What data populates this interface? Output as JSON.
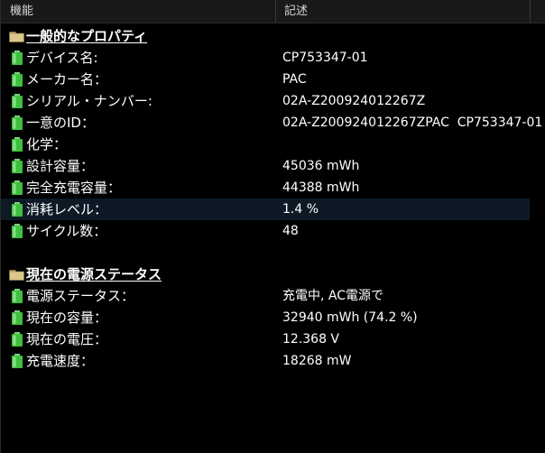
{
  "header": {
    "col_item": "機能",
    "col_desc": "記述"
  },
  "sections": [
    {
      "title": "一般的なプロパティ",
      "rows": [
        {
          "label": "デバイス名:",
          "value": "CP753347-01"
        },
        {
          "label": "メーカー名：",
          "value": "PAC"
        },
        {
          "label": "シリアル・ナンバー:",
          "value": "02A-Z200924012267Z"
        },
        {
          "label": "一意のID：",
          "value": "02A-Z200924012267ZPAC  CP753347-01"
        },
        {
          "label": "化学：",
          "value": ""
        },
        {
          "label": "設計容量：",
          "value": "45036 mWh"
        },
        {
          "label": "完全充電容量：",
          "value": "44388 mWh"
        },
        {
          "label": "消耗レベル：",
          "value": "1.4 %"
        },
        {
          "label": "サイクル数：",
          "value": "48"
        }
      ]
    },
    {
      "title": "現在の電源ステータス",
      "rows": [
        {
          "label": "電源ステータス：",
          "value": "充電中, AC電源で"
        },
        {
          "label": "現在の容量：",
          "value": "32940 mWh (74.2 %)"
        },
        {
          "label": "現在の電圧：",
          "value": "12.368 V"
        },
        {
          "label": "充電速度：",
          "value": "18268 mW"
        }
      ]
    }
  ],
  "icons": {
    "section": "folder-icon",
    "item": "battery-icon"
  },
  "colors": {
    "background": "#000000",
    "header_bg": "#191919",
    "text": "#ffffff",
    "selection": "#0d1a26",
    "battery_green": "#3fbf3f"
  }
}
